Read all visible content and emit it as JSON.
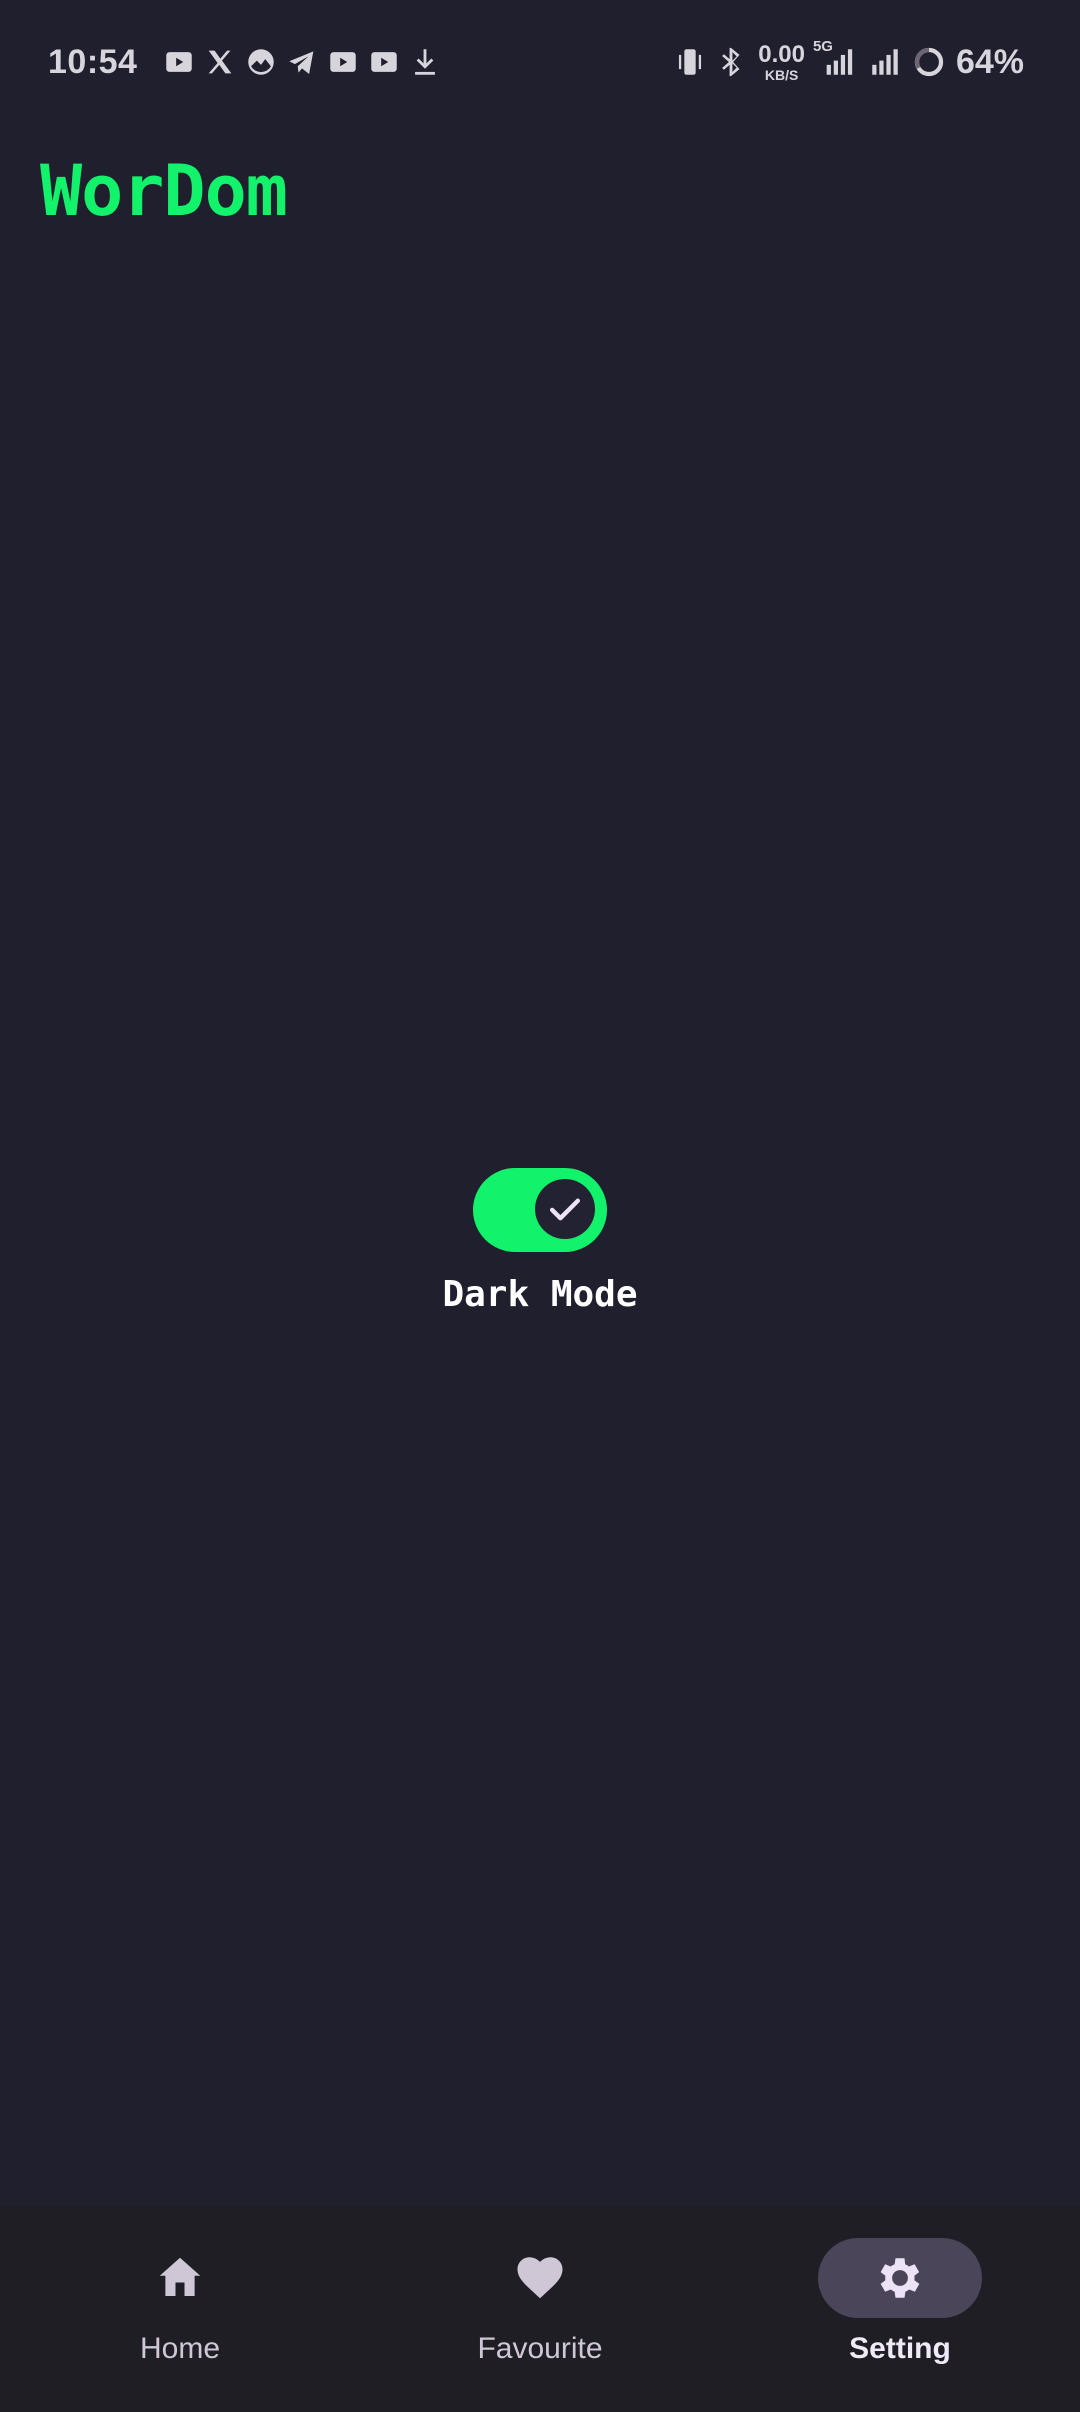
{
  "status_bar": {
    "time": "10:54",
    "notification_icons": [
      "youtube-icon",
      "x-icon",
      "gallery-icon",
      "telegram-icon",
      "youtube-icon",
      "youtube-icon",
      "download-icon"
    ],
    "network_speed": "0.00",
    "network_speed_unit": "KB/S",
    "network_type": "5G",
    "battery": "64%"
  },
  "app": {
    "title": "WorDom",
    "accent_color": "#12f26a",
    "background_color": "#1f1f2e"
  },
  "settings": {
    "dark_mode_label": "Dark Mode",
    "dark_mode_enabled": true
  },
  "bottom_nav": {
    "items": [
      {
        "label": "Home",
        "icon": "home-icon",
        "active": false
      },
      {
        "label": "Favourite",
        "icon": "heart-icon",
        "active": false
      },
      {
        "label": "Setting",
        "icon": "gear-icon",
        "active": true
      }
    ]
  }
}
